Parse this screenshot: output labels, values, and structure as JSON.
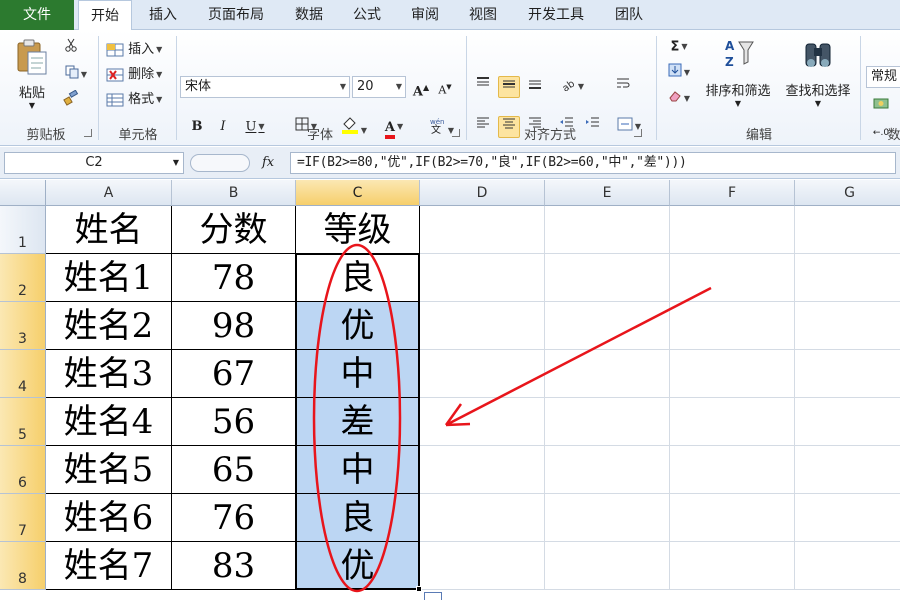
{
  "tabs": [
    "文件",
    "开始",
    "插入",
    "页面布局",
    "数据",
    "公式",
    "审阅",
    "视图",
    "开发工具",
    "团队"
  ],
  "ribbon": {
    "clipboard": {
      "paste": "粘贴",
      "group": "剪贴板"
    },
    "cells": {
      "insert": "插入",
      "delete": "删除",
      "format": "格式",
      "group": "单元格"
    },
    "font": {
      "name": "宋体",
      "size": "20",
      "bold": "B",
      "italic": "I",
      "underline": "U",
      "font_color_letter": "A",
      "grow_letter": "A",
      "group": "字体"
    },
    "align": {
      "group": "对齐方式"
    },
    "editing": {
      "sort": "排序和筛选",
      "find": "查找和选择",
      "sum_symbol": "Σ",
      "group": "编辑"
    },
    "number": {
      "format": "常规",
      "group_partial": "数"
    }
  },
  "formula_bar": {
    "name_box": "C2",
    "fx": "fx",
    "formula": "=IF(B2>=80,\"优\",IF(B2>=70,\"良\",IF(B2>=60,\"中\",\"差\")))"
  },
  "sheet": {
    "columns": [
      "A",
      "B",
      "C",
      "D",
      "E",
      "F",
      "G"
    ],
    "rows": [
      "1",
      "2",
      "3",
      "4",
      "5",
      "6",
      "7",
      "8"
    ],
    "header_row": [
      "姓名",
      "分数",
      "等级"
    ],
    "data": [
      [
        "姓名1",
        "78",
        "良"
      ],
      [
        "姓名2",
        "98",
        "优"
      ],
      [
        "姓名3",
        "67",
        "中"
      ],
      [
        "姓名4",
        "56",
        "差"
      ],
      [
        "姓名5",
        "65",
        "中"
      ],
      [
        "姓名6",
        "76",
        "良"
      ],
      [
        "姓名7",
        "83",
        "优"
      ]
    ]
  },
  "colors": {
    "file_tab": "#2c7a2f",
    "selection": "#bcd6f3",
    "annotation": "#e8151b"
  }
}
